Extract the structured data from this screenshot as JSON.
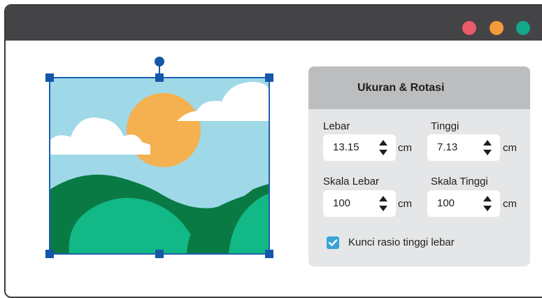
{
  "window": {
    "controls": [
      {
        "name": "close",
        "color": "#e95a6a"
      },
      {
        "name": "minimize",
        "color": "#f39a3a"
      },
      {
        "name": "maximize",
        "color": "#13a88a"
      }
    ]
  },
  "panel": {
    "title": "Ukuran & Rotasi",
    "width": {
      "label": "Lebar",
      "value": "13.15",
      "unit": "cm"
    },
    "height": {
      "label": "Tinggi",
      "value": "7.13",
      "unit": "cm"
    },
    "scale_width": {
      "label": "Skala Lebar",
      "value": "100",
      "unit": "cm"
    },
    "scale_height": {
      "label": "Skala Tinggi",
      "value": "100",
      "unit": "cm"
    },
    "lock_ratio": {
      "label": "Kunci rasio tinggi lebar",
      "checked": true
    }
  },
  "colors": {
    "accent": "#1557a8",
    "checkbox": "#3aa3d6",
    "sky": "#9fd9e8",
    "sun": "#f5b04f",
    "hill_light": "#12b886",
    "hill_dark": "#0a7a45"
  },
  "image": {
    "icon": "landscape-image-icon"
  }
}
